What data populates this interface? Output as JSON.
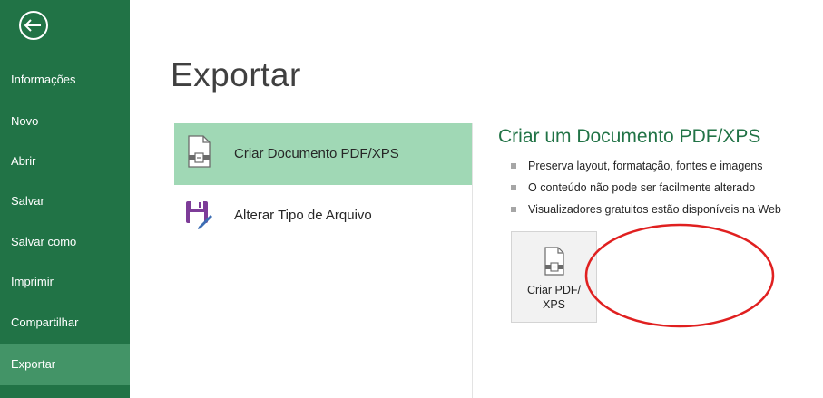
{
  "sidebar": {
    "back_icon": "back-arrow-icon",
    "items": [
      {
        "label": "Informações",
        "active": false
      },
      {
        "label": "Novo",
        "active": false
      },
      {
        "label": "Abrir",
        "active": false
      },
      {
        "label": "Salvar",
        "active": false
      },
      {
        "label": "Salvar como",
        "active": false
      },
      {
        "label": "Imprimir",
        "active": false
      },
      {
        "label": "Compartilhar",
        "active": false
      },
      {
        "label": "Exportar",
        "active": true
      }
    ]
  },
  "main": {
    "title": "Exportar",
    "options": [
      {
        "label": "Criar Documento PDF/XPS",
        "icon": "pdf-document-icon",
        "selected": true
      },
      {
        "label": "Alterar Tipo de Arquivo",
        "icon": "save-file-type-icon",
        "selected": false
      }
    ],
    "detail": {
      "title": "Criar um Documento PDF/XPS",
      "bullets": [
        "Preserva layout, formatação, fontes e imagens",
        "O conteúdo não pode ser facilmente alterado",
        "Visualizadores gratuitos estão disponíveis na Web"
      ],
      "button_label": "Criar PDF/\nXPS",
      "button_icon": "pdf-document-icon"
    }
  },
  "colors": {
    "sidebar_bg": "#217346",
    "sidebar_active": "#439467",
    "selected_option": "#a0d8b5",
    "accent_title": "#217346",
    "annotation": "#e02020"
  }
}
